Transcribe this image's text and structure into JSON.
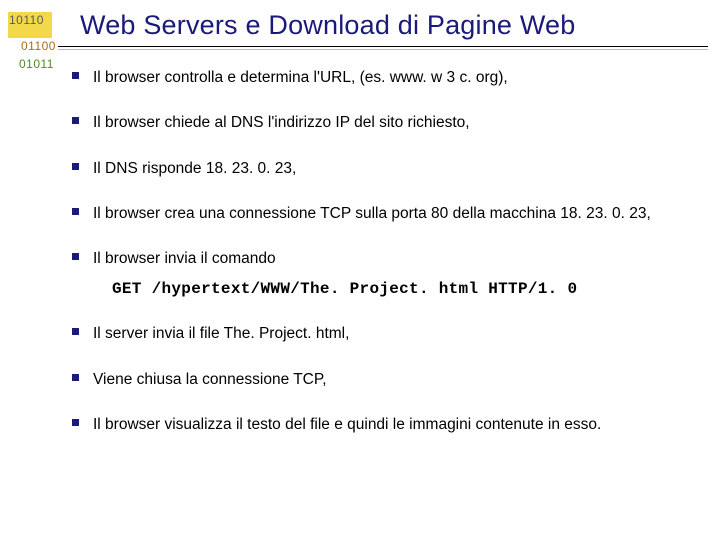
{
  "deco": {
    "line1": "10110",
    "line2": "01100",
    "line3": "01011"
  },
  "title": "Web Servers e Download di Pagine Web",
  "bullets": [
    "Il browser controlla e determina l'URL, (es. www. w 3 c. org),",
    "Il browser chiede al DNS l'indirizzo IP del sito richiesto,",
    "Il DNS risponde 18. 23. 0. 23,",
    "Il browser crea una connessione TCP sulla porta 80 della macchina 18. 23. 0. 23,",
    "Il browser invia il comando"
  ],
  "command": "GET /hypertext/WWW/The. Project. html HTTP/1. 0",
  "bullets2": [
    "Il server invia il file The. Project. html,",
    "Viene chiusa la connessione TCP,",
    "Il browser visualizza il testo del file e quindi le immagini contenute in esso."
  ]
}
